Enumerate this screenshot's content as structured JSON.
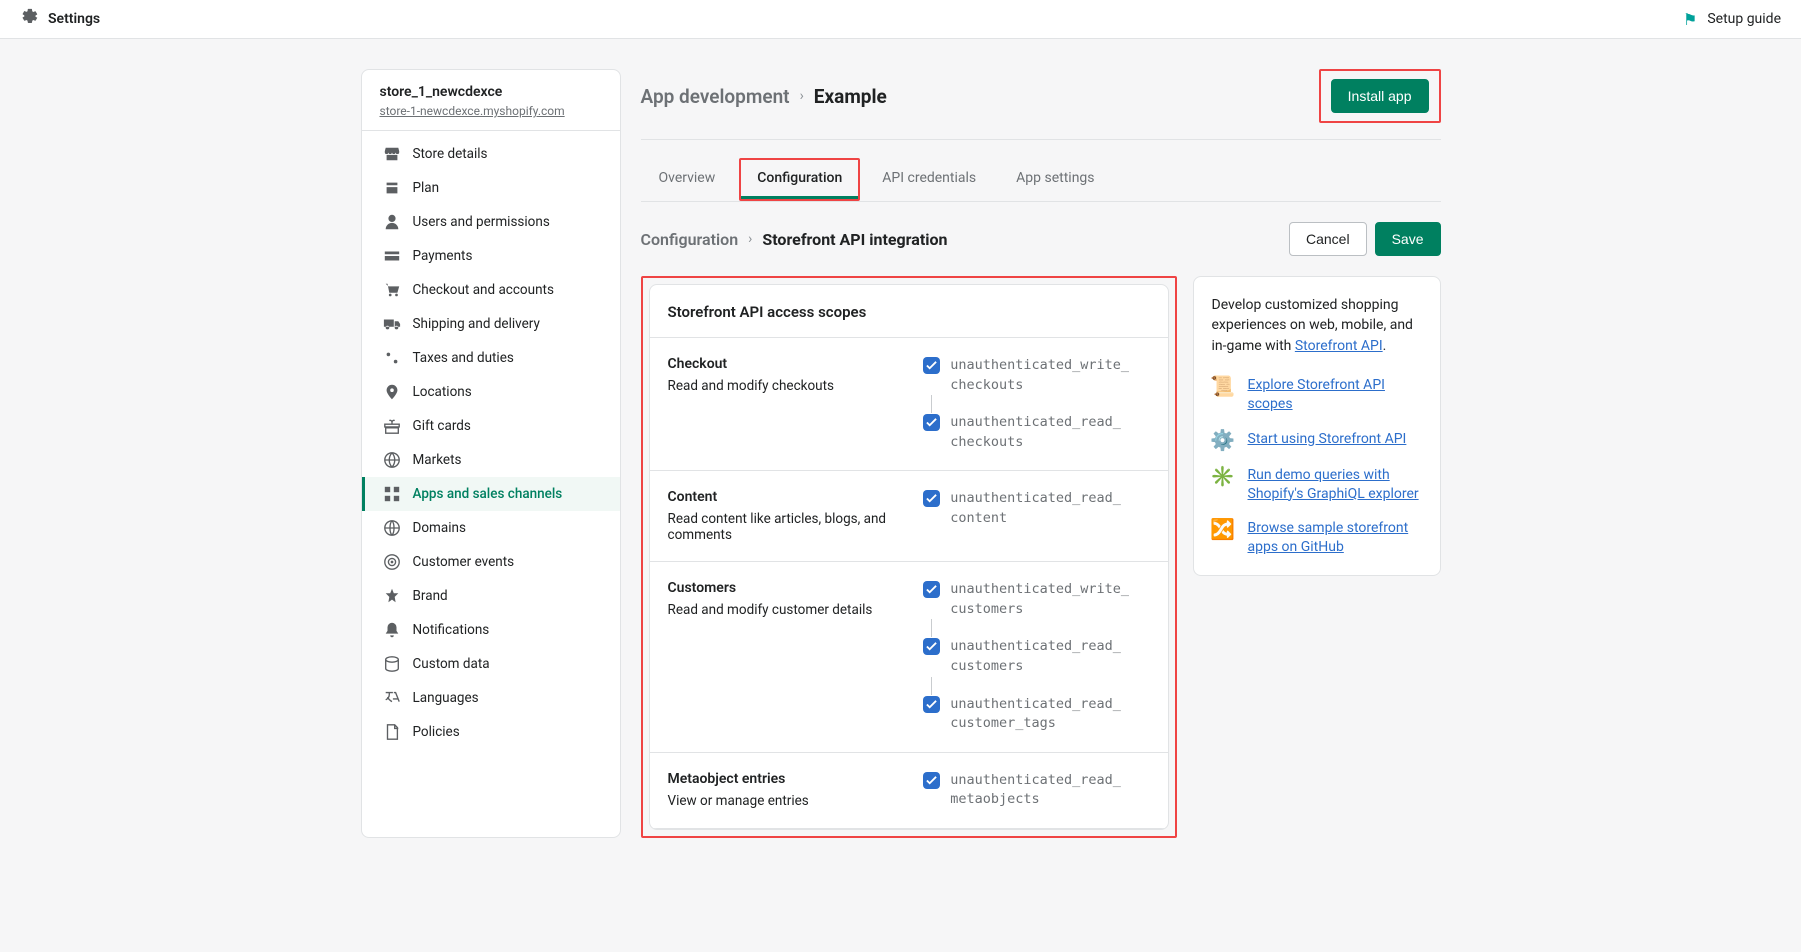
{
  "topbar": {
    "settings_label": "Settings",
    "setup_guide_label": "Setup guide"
  },
  "sidebar": {
    "store_name": "store_1_newcdexce",
    "store_url": "store-1-newcdexce.myshopify.com",
    "items": [
      {
        "label": "Store details",
        "icon": "store"
      },
      {
        "label": "Plan",
        "icon": "plan"
      },
      {
        "label": "Users and permissions",
        "icon": "user"
      },
      {
        "label": "Payments",
        "icon": "payments"
      },
      {
        "label": "Checkout and accounts",
        "icon": "cart"
      },
      {
        "label": "Shipping and delivery",
        "icon": "truck"
      },
      {
        "label": "Taxes and duties",
        "icon": "tax"
      },
      {
        "label": "Locations",
        "icon": "pin"
      },
      {
        "label": "Gift cards",
        "icon": "gift"
      },
      {
        "label": "Markets",
        "icon": "globe"
      },
      {
        "label": "Apps and sales channels",
        "icon": "apps",
        "active": true
      },
      {
        "label": "Domains",
        "icon": "domain"
      },
      {
        "label": "Customer events",
        "icon": "target"
      },
      {
        "label": "Brand",
        "icon": "brand"
      },
      {
        "label": "Notifications",
        "icon": "bell"
      },
      {
        "label": "Custom data",
        "icon": "data"
      },
      {
        "label": "Languages",
        "icon": "lang"
      },
      {
        "label": "Policies",
        "icon": "policy"
      }
    ]
  },
  "header": {
    "breadcrumb_root": "App development",
    "breadcrumb_current": "Example",
    "install_label": "Install app"
  },
  "tabs": [
    {
      "label": "Overview"
    },
    {
      "label": "Configuration",
      "active": true,
      "highlight": true
    },
    {
      "label": "API credentials"
    },
    {
      "label": "App settings"
    }
  ],
  "sub": {
    "breadcrumb_root": "Configuration",
    "breadcrumb_current": "Storefront API integration",
    "cancel_label": "Cancel",
    "save_label": "Save"
  },
  "card": {
    "title": "Storefront API access scopes",
    "sections": [
      {
        "title": "Checkout",
        "desc": "Read and modify checkouts",
        "scopes": [
          "unauthenticated_write_checkouts",
          "unauthenticated_read_checkouts"
        ]
      },
      {
        "title": "Content",
        "desc": "Read content like articles, blogs, and comments",
        "scopes": [
          "unauthenticated_read_content"
        ]
      },
      {
        "title": "Customers",
        "desc": "Read and modify customer details",
        "scopes": [
          "unauthenticated_write_customers",
          "unauthenticated_read_customers",
          "unauthenticated_read_customer_tags"
        ]
      },
      {
        "title": "Metaobject entries",
        "desc": "View or manage entries",
        "scopes": [
          "unauthenticated_read_metaobjects"
        ]
      }
    ]
  },
  "info": {
    "blurb_pre": "Develop customized shopping experiences on web, mobile, and in-game with ",
    "blurb_link": "Storefront API",
    "blurb_post": ".",
    "links": [
      {
        "label": "Explore Storefront API scopes",
        "icon": "scroll"
      },
      {
        "label": "Start using Storefront API",
        "icon": "gear-color"
      },
      {
        "label": "Run demo queries with Shopify's GraphiQL explorer",
        "icon": "sparkle"
      },
      {
        "label": "Browse sample storefront apps on GitHub",
        "icon": "branch"
      }
    ]
  }
}
